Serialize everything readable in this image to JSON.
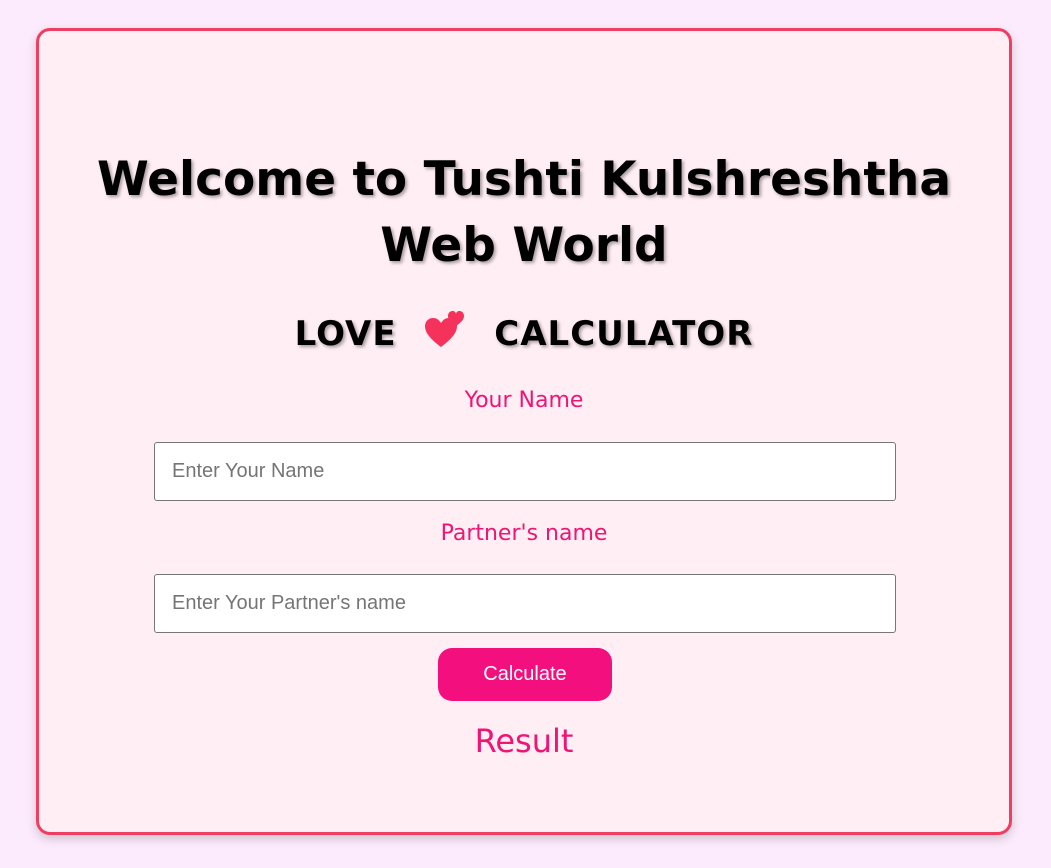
{
  "heading": {
    "line1": "Welcome to Tushti Kulshreshtha",
    "line2": "Web World"
  },
  "subtitle": {
    "left": "LOVE",
    "icon": "two-hearts-icon",
    "right": "CALCULATOR"
  },
  "form": {
    "name_label": "Your Name",
    "name_placeholder": "Enter Your Name",
    "name_value": "",
    "partner_label": "Partner's name",
    "partner_placeholder": "Enter Your Partner's name",
    "partner_value": "",
    "button_label": "Calculate"
  },
  "result": {
    "text": "Result"
  },
  "colors": {
    "page_background": "#fcebfc",
    "card_background": "#ffeef3",
    "card_border": "#f03e63",
    "accent": "#ee1574",
    "button": "#f30f7d",
    "heart": "#f5325c"
  }
}
